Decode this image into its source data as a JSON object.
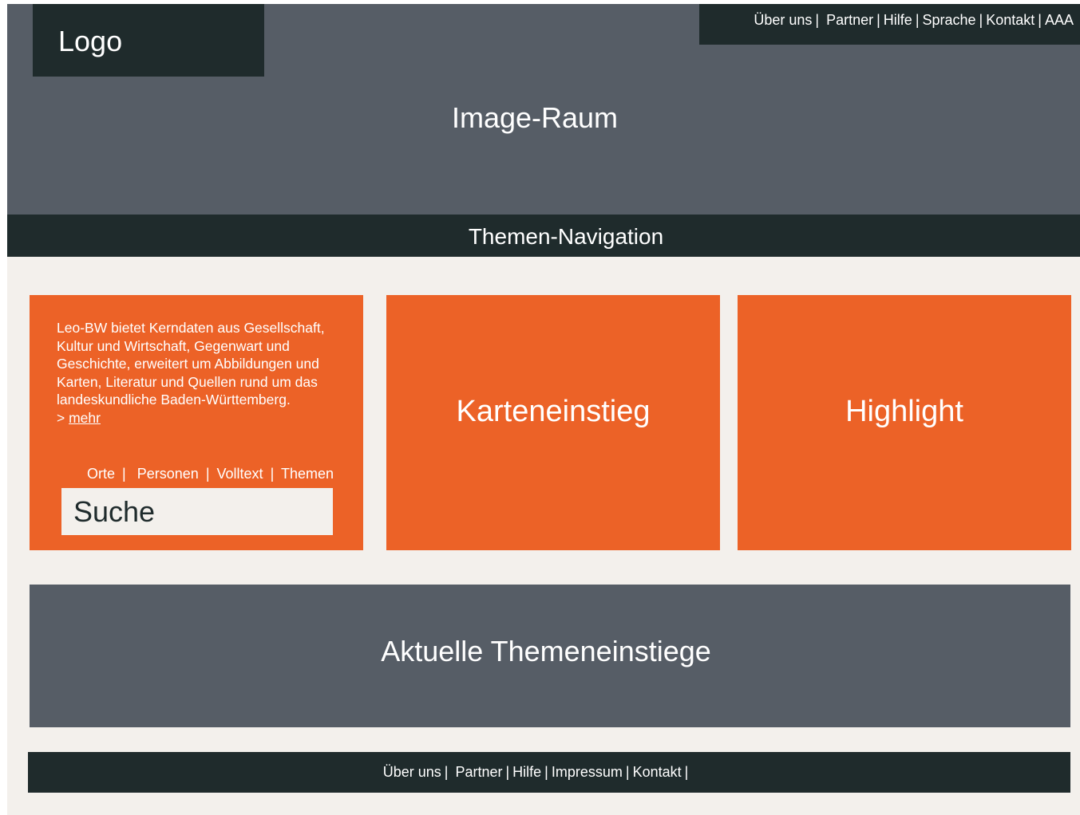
{
  "header": {
    "logo": "Logo",
    "hero_title": "Image-Raum",
    "top_nav": {
      "uber_uns": "Über uns",
      "partner": "Partner",
      "hilfe": "Hilfe",
      "sprache": "Sprache",
      "kontakt": "Kontakt",
      "aaa": "AAA"
    }
  },
  "themen_navigation": "Themen-Navigation",
  "intro": {
    "text": "Leo-BW bietet Kerndaten aus Gesellschaft, Kultur und Wirtschaft, Gegenwart und Geschichte, erweitert um Abbildungen und Karten, Literatur und Quellen rund um das landeskundliche Baden-Württemberg.",
    "more_prefix": "> ",
    "more_link": "mehr",
    "search_links": {
      "orte": "Orte",
      "personen": "Personen",
      "volltext": "Volltext",
      "themen": "Themen"
    },
    "search_placeholder": "Suche"
  },
  "tiles": {
    "karteneinstieg": "Karteneinstieg",
    "highlight": "Highlight"
  },
  "aktuelle": "Aktuelle Themeneinstiege",
  "footer": {
    "uber_uns": "Über uns",
    "partner": "Partner",
    "hilfe": "Hilfe",
    "impressum": "Impressum",
    "kontakt": "Kontakt"
  },
  "colors": {
    "dark": "#1f2b2c",
    "slate": "#565d66",
    "orange": "#ec6227",
    "background": "#f3f0ec"
  }
}
